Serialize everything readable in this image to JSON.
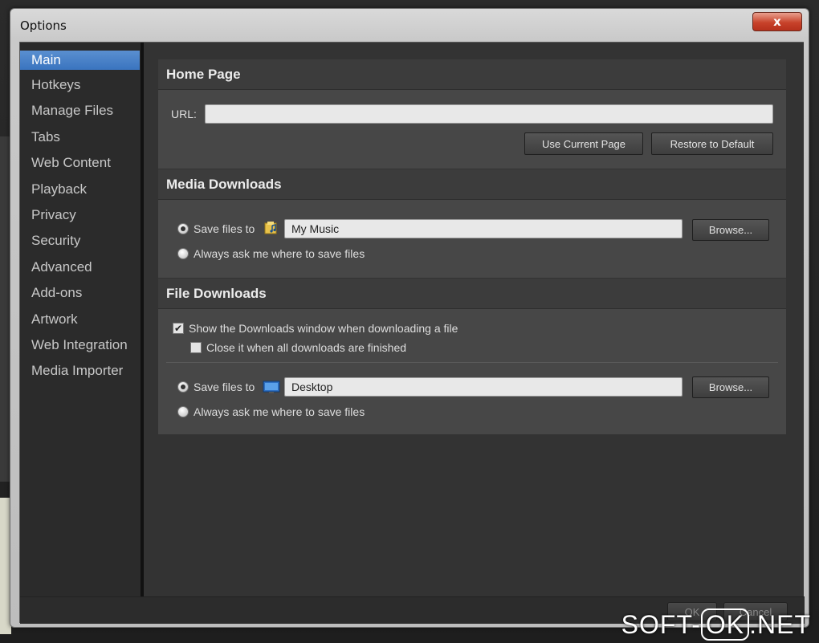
{
  "window": {
    "title": "Options",
    "close_label": "x"
  },
  "sidebar": {
    "items": [
      {
        "label": "Main",
        "active": true
      },
      {
        "label": "Hotkeys"
      },
      {
        "label": "Manage Files"
      },
      {
        "label": "Tabs"
      },
      {
        "label": "Web Content"
      },
      {
        "label": "Playback"
      },
      {
        "label": "Privacy"
      },
      {
        "label": "Security"
      },
      {
        "label": "Advanced"
      },
      {
        "label": "Add-ons"
      },
      {
        "label": "Artwork"
      },
      {
        "label": "Web Integration"
      },
      {
        "label": "Media Importer"
      }
    ]
  },
  "home_page": {
    "header": "Home Page",
    "url_label": "URL:",
    "url_value": "",
    "use_current_label": "Use Current Page",
    "restore_label": "Restore to Default"
  },
  "media_downloads": {
    "header": "Media Downloads",
    "save_files_label": "Save files to",
    "save_path": "My Music",
    "browse_label": "Browse...",
    "always_ask_label": "Always ask me where to save files"
  },
  "file_downloads": {
    "header": "File Downloads",
    "show_window_label": "Show the Downloads window when downloading a file",
    "close_when_done_label": "Close it when all downloads are finished",
    "save_files_label": "Save files to",
    "save_path": "Desktop",
    "browse_label": "Browse...",
    "always_ask_label": "Always ask me where to save files"
  },
  "footer": {
    "ok_label": "OK",
    "cancel_label": "Cancel"
  },
  "watermark": {
    "left": "SOFT-",
    "box": "OK",
    "right": ".NET"
  },
  "colors": {
    "accent": "#3a74bf",
    "close": "#c8432b"
  }
}
